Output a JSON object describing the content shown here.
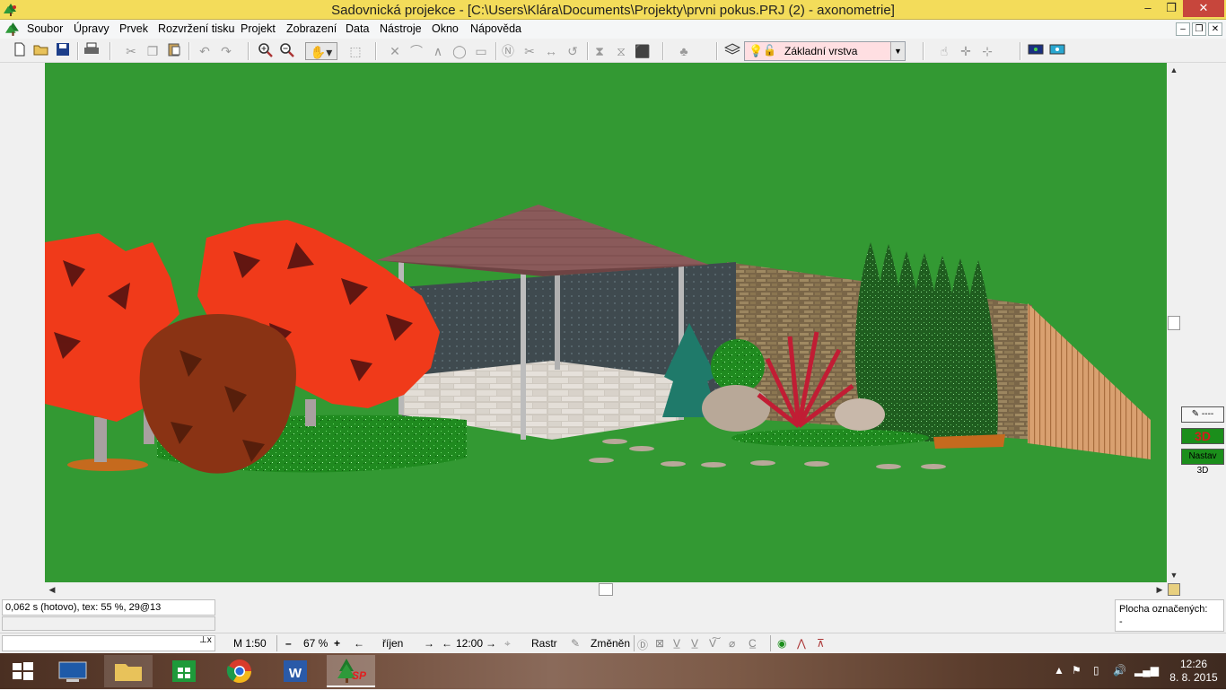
{
  "window": {
    "title": "Sadovnická projekce - [C:\\Users\\Klára\\Documents\\Projekty\\prvni pokus.PRJ (2) - axonometrie]",
    "min_glyph": "–",
    "max_glyph": "❐",
    "close_glyph": "✕"
  },
  "menu": {
    "items": [
      "Soubor",
      "Úpravy",
      "Prvek",
      "Rozvržení tisku",
      "Projekt",
      "Zobrazení",
      "Data",
      "Nástroje",
      "Okno",
      "Nápověda"
    ],
    "mdi_min": "–",
    "mdi_restore": "❐",
    "mdi_close": "✕"
  },
  "toolbar": {
    "layer_name": "Základní vrstva",
    "icons": [
      "new-file",
      "open-folder",
      "save",
      "print",
      "cut",
      "copy",
      "paste",
      "undo",
      "redo",
      "zoom-in",
      "zoom-out",
      "pan-hand",
      "move-object",
      "delete",
      "arc",
      "polyline",
      "ellipse",
      "rectangle",
      "node",
      "scissors",
      "measure",
      "rotate",
      "mirror-vertical",
      "mirror-horizontal",
      "fit",
      "plant",
      "layers",
      "bulb",
      "lock"
    ]
  },
  "side_panel": {
    "btn_3d_label": "3D",
    "nastav_label": "Nastav 3D",
    "line_label": "----"
  },
  "status": {
    "render_info": "0,062 s (hotovo), tex: 55 %, 29@13",
    "marked_title": "Plocha označených:",
    "marked_value": "-"
  },
  "bottom": {
    "scale": "M 1:50",
    "zoom": "67 %",
    "month": "říjen",
    "time": "12:00",
    "raster": "Rastr",
    "changed": "Změněn"
  },
  "taskbar": {
    "apps": [
      "start",
      "lenovo",
      "file-explorer",
      "store",
      "chrome",
      "word",
      "sadovnicka-projekce"
    ],
    "sp_label": "SP",
    "time": "12:26",
    "date": "8. 8. 2015"
  },
  "colors": {
    "titlebar": "#f3dc5a",
    "viewport_grass": "#339933",
    "layer_bg": "#ffdfe2",
    "close_red": "#c7463c"
  }
}
